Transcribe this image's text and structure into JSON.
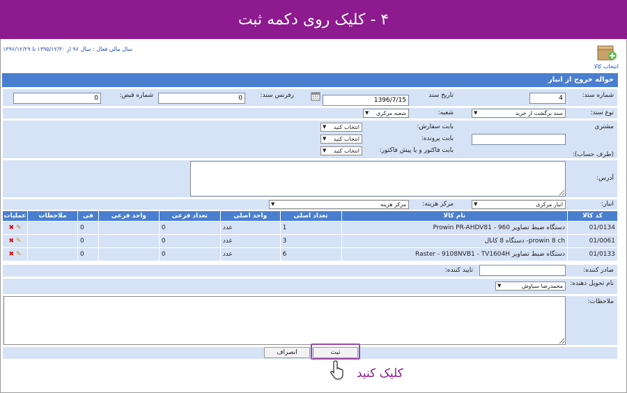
{
  "banner": {
    "title": "۴ - کلیک روی دکمه ثبت"
  },
  "top": {
    "active_year": "سال مالي فعال : سال ۹۶ از ۱۳۹۵/۱۲/۳۰ تا ۱۳۹۶/۱۲/۲۹",
    "select_goods": "انتخاب کالا"
  },
  "form": {
    "title": "حواله خروج از انبار",
    "doc_number_label": "شماره سند:",
    "doc_number": "4",
    "doc_date_label": "تاریخ سند",
    "doc_date": "1396/7/15",
    "doc_ref_label": "رفرنس سند:",
    "doc_ref": "0",
    "receipt_number_label": "شماره قبض:",
    "receipt_number": "0",
    "doc_type_label": "نوع سند:",
    "doc_type": "سند برگشت از خرید",
    "branch_label": "شعبه:",
    "branch": "شعبه مرکزی",
    "customer_label": "مشتری",
    "account_side_label": "(طرف حساب):",
    "order_label": "بابت سفارش:",
    "order_value": "انتخاب کنید",
    "case_label": "بابت پرونده:",
    "case_value": "انتخاب کنید",
    "invoice_label": "بابت فاکتور و یا پیش فاکتور:",
    "invoice_value": "انتخاب کنید",
    "address_label": "آدرس:",
    "warehouse_label": "انبار:",
    "warehouse": "انبار مرکزی",
    "cost_center_label": "مرکز هزینه:",
    "cost_center": "مرکز هزینه",
    "issuer_label": "صادر کننده:",
    "approver_label": "تایید کننده:",
    "deliverer_label": "نام تحویل دهنده:",
    "deliverer": "محمدرضا سیاوش",
    "notes_label": "ملاحظات:"
  },
  "table": {
    "headers": [
      "کد کالا",
      "نام کالا",
      "تعداد اصلی",
      "واحد اصلی",
      "تعداد فرعی",
      "واحد فرعی",
      "فی",
      "ملاحظات",
      "عملیات"
    ],
    "rows": [
      {
        "code": "01/0134",
        "name": "دستگاه ضبط تصاویر 960 - Prowin PR-AHDV81",
        "qty": "1",
        "unit": "عدد",
        "sub_qty": "0",
        "sub_unit": "",
        "price": "0",
        "notes": ""
      },
      {
        "code": "01/0061",
        "name": "prowin 8 ch- دستگاه 8 کانال",
        "qty": "3",
        "unit": "عدد",
        "sub_qty": "0",
        "sub_unit": "",
        "price": "0",
        "notes": ""
      },
      {
        "code": "01/0133",
        "name": "دستگاه ضبط تصاویر Raster - 9108NVB1 - TV1604H",
        "qty": "6",
        "unit": "عدد",
        "sub_qty": "0",
        "sub_unit": "",
        "price": "0",
        "notes": ""
      }
    ]
  },
  "buttons": {
    "submit": "ثبت",
    "cancel": "انصراف"
  },
  "hint": {
    "click_text": "کلیک کنید"
  },
  "colors": {
    "banner": "#8d1a8e",
    "header_blue": "#4a7fd0",
    "cell_blue": "#d6e2f5",
    "highlight": "#a046a8"
  }
}
